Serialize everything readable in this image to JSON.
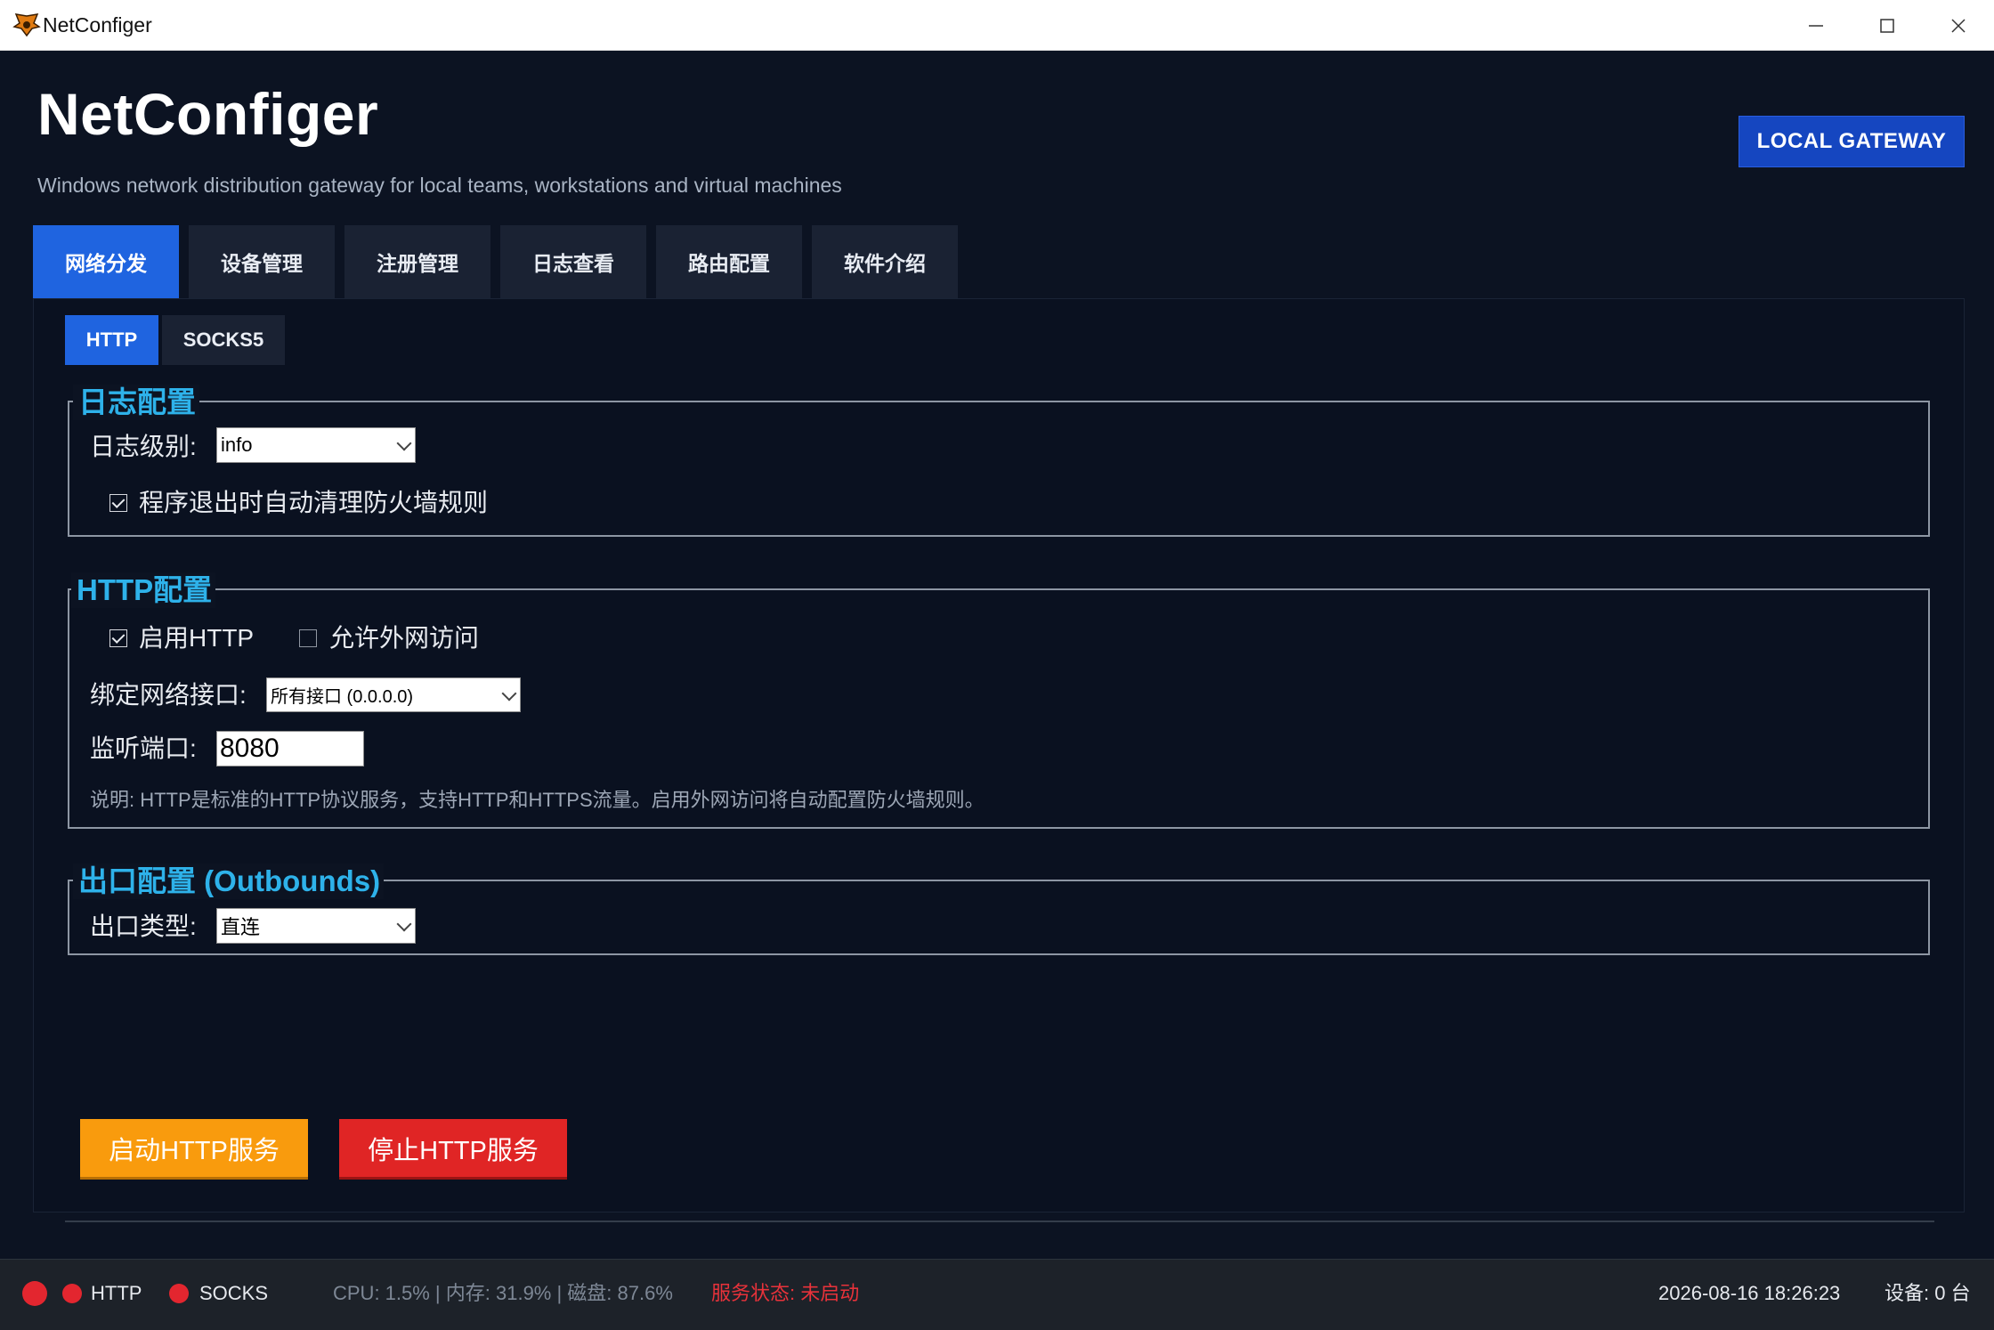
{
  "window": {
    "title": "NetConfiger"
  },
  "header": {
    "app_name": "NetConfiger",
    "description": "Windows network distribution gateway for local teams, workstations and virtual machines",
    "badge": "LOCAL GATEWAY"
  },
  "main_tabs": [
    {
      "label": "网络分发",
      "active": true
    },
    {
      "label": "设备管理",
      "active": false
    },
    {
      "label": "注册管理",
      "active": false
    },
    {
      "label": "日志查看",
      "active": false
    },
    {
      "label": "路由配置",
      "active": false
    },
    {
      "label": "软件介绍",
      "active": false
    }
  ],
  "sub_tabs": [
    {
      "label": "HTTP",
      "active": true
    },
    {
      "label": "SOCKS5",
      "active": false
    }
  ],
  "log_config": {
    "title": "日志配置",
    "level_label": "日志级别:",
    "level_value": "info",
    "cleanup_checkbox_label": "程序退出时自动清理防火墙规则",
    "cleanup_checked": true
  },
  "http_config": {
    "title": "HTTP配置",
    "enable_label": "启用HTTP",
    "enable_checked": true,
    "external_label": "允许外网访问",
    "external_checked": false,
    "bind_label": "绑定网络接口:",
    "bind_value": "所有接口 (0.0.0.0)",
    "port_label": "监听端口:",
    "port_value": "8080",
    "note": "说明: HTTP是标准的HTTP协议服务，支持HTTP和HTTPS流量。启用外网访问将自动配置防火墙规则。"
  },
  "outbound_config": {
    "title": "出口配置 (Outbounds)",
    "type_label": "出口类型:",
    "type_value": "直连"
  },
  "actions": {
    "start_label": "启动HTTP服务",
    "stop_label": "停止HTTP服务"
  },
  "status_bar": {
    "http_label": "HTTP",
    "socks_label": "SOCKS",
    "system_stats": "CPU: 1.5% | 内存: 31.9% | 磁盘: 87.6%",
    "service_status": "服务状态: 未启动",
    "datetime": "2026-08-16 18:26:23",
    "device_count": "设备: 0 台"
  },
  "colors": {
    "accent_blue": "#1f64e0",
    "group_title": "#2eb2ea",
    "start_button": "#f99b0d",
    "stop_button": "#e02525",
    "status_red": "#e3262f"
  }
}
